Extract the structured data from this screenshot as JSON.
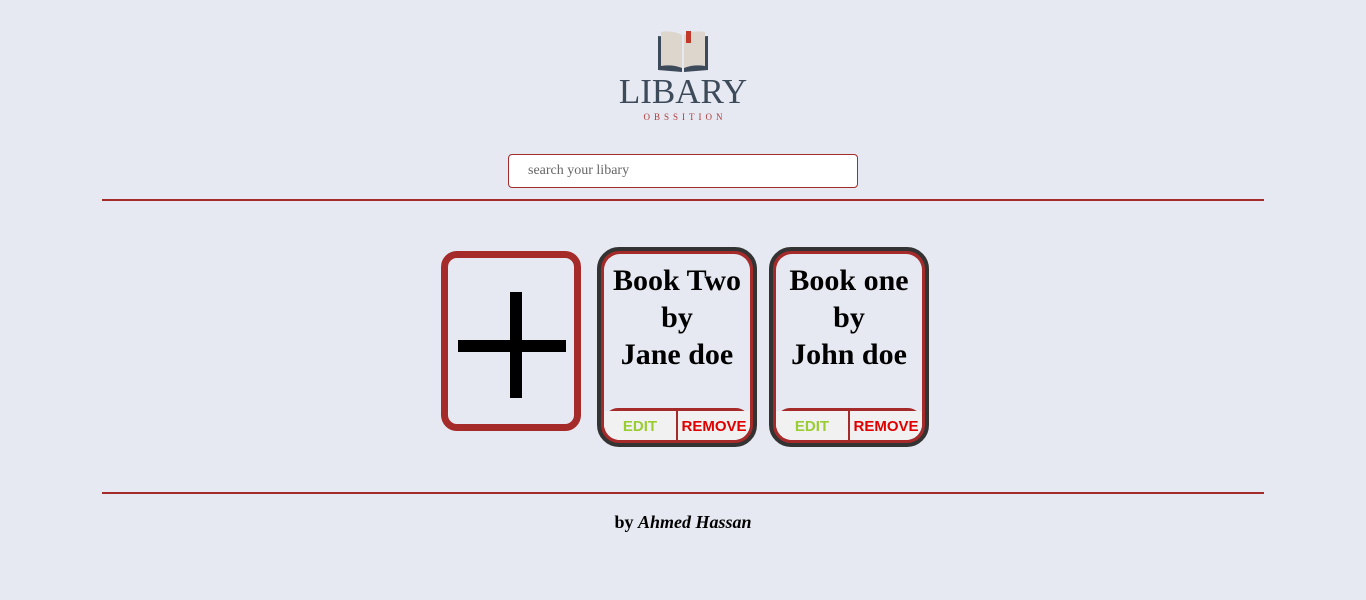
{
  "logo": {
    "title": "LIBARY",
    "subtitle": "OBSSITION",
    "icon": "open-book-icon",
    "colors": {
      "title": "#3d4a5a",
      "subtitle": "#b03a3a",
      "bookmark": "#c0392b"
    }
  },
  "search": {
    "placeholder": "search your libary",
    "value": ""
  },
  "add_card": {
    "icon": "plus-icon"
  },
  "books": [
    {
      "title": "Book Two",
      "by": "by",
      "author": "Jane doe",
      "edit_label": "EDIT",
      "remove_label": "REMOVE"
    },
    {
      "title": "Book one",
      "by": "by",
      "author": "John doe",
      "edit_label": "EDIT",
      "remove_label": "REMOVE"
    }
  ],
  "footer": {
    "prefix": "by",
    "author": "Ahmed Hassan"
  },
  "colors": {
    "background": "#e6e9f1",
    "accent": "#a52a2a",
    "card_border": "#333333",
    "edit": "#9acd32",
    "remove": "#e00000"
  }
}
